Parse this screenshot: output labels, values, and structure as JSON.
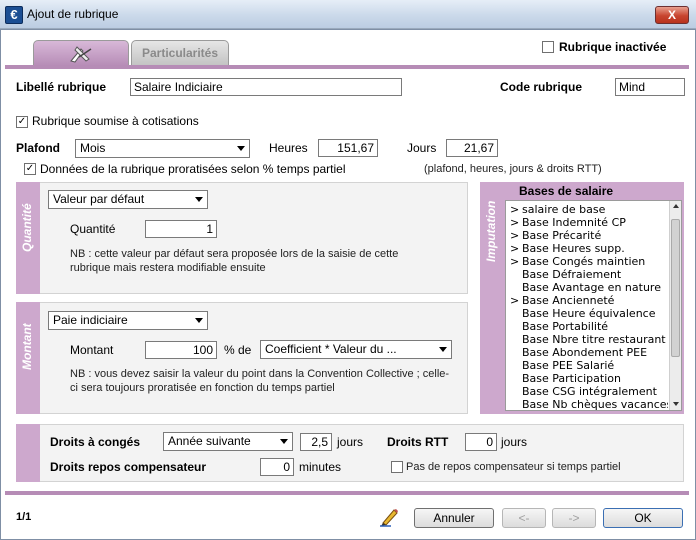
{
  "window": {
    "title": "Ajout de rubrique",
    "close_label": "X",
    "app_icon": "€"
  },
  "tabs": {
    "second": "Particularités"
  },
  "inactive_label": "Rubrique inactivée",
  "libelle": {
    "label": "Libellé rubrique",
    "value": "Salaire Indiciaire"
  },
  "code": {
    "label": "Code rubrique",
    "value": "Mind"
  },
  "cotisations_label": "Rubrique soumise à cotisations",
  "plafond": {
    "label": "Plafond",
    "value": "Mois",
    "heures_label": "Heures",
    "heures_value": "151,67",
    "jours_label": "Jours",
    "jours_value": "21,67"
  },
  "prorata": {
    "label": "Données de la rubrique proratisées selon % temps partiel",
    "hint": "(plafond, heures, jours & droits RTT)"
  },
  "quantite": {
    "side_label": "Quantité",
    "combo": "Valeur par défaut",
    "field_label": "Quantité",
    "value": "1",
    "note": "NB : cette valeur par défaut sera proposée lors de la saisie de cette rubrique mais restera modifiable ensuite"
  },
  "montant": {
    "side_label": "Montant",
    "combo": "Paie indiciaire",
    "field_label": "Montant",
    "value": "100",
    "pct_label": "% de",
    "base_combo": "Coefficient * Valeur du ...",
    "note": "NB : vous devez saisir la valeur du point dans la Convention Collective ; celle-ci sera toujours proratisée en fonction du temps partiel"
  },
  "imputation": {
    "side_label": "Imputation",
    "header": "Bases de salaire",
    "items": [
      {
        "mark": ">",
        "label": "salaire de base"
      },
      {
        "mark": ">",
        "label": "Base Indemnité CP"
      },
      {
        "mark": ">",
        "label": "Base Précarité"
      },
      {
        "mark": ">",
        "label": "Base Heures supp."
      },
      {
        "mark": ">",
        "label": "Base Congés maintien"
      },
      {
        "mark": "",
        "label": "Base Défraiement"
      },
      {
        "mark": "",
        "label": "Base Avantage en nature"
      },
      {
        "mark": ">",
        "label": "Base Ancienneté"
      },
      {
        "mark": "",
        "label": "Base Heure équivalence"
      },
      {
        "mark": "",
        "label": "Base Portabilité"
      },
      {
        "mark": "",
        "label": "Base Nbre titre restaurant"
      },
      {
        "mark": "",
        "label": "Base Abondement PEE"
      },
      {
        "mark": "",
        "label": "Base PEE Salarié"
      },
      {
        "mark": "",
        "label": "Base Participation"
      },
      {
        "mark": "",
        "label": "Base CSG intégralement"
      },
      {
        "mark": "",
        "label": "Base Nb chèques vacances"
      }
    ]
  },
  "droits": {
    "conges_label": "Droits à congés",
    "conges_combo": "Année suivante",
    "conges_value": "2,5",
    "jours_label": "jours",
    "rtt_label": "Droits RTT",
    "rtt_value": "0",
    "rtt_unit": "jours",
    "repos_label": "Droits repos compensateur",
    "repos_value": "0",
    "repos_unit": "minutes",
    "repos_chk_label": "Pas de repos compensateur si temps partiel"
  },
  "footer": {
    "page": "1/1",
    "cancel": "Annuler",
    "prev": "<-",
    "next": "->",
    "ok": "OK"
  },
  "colors": {
    "accent": "#b68cb6",
    "side": "#cda8cd"
  }
}
